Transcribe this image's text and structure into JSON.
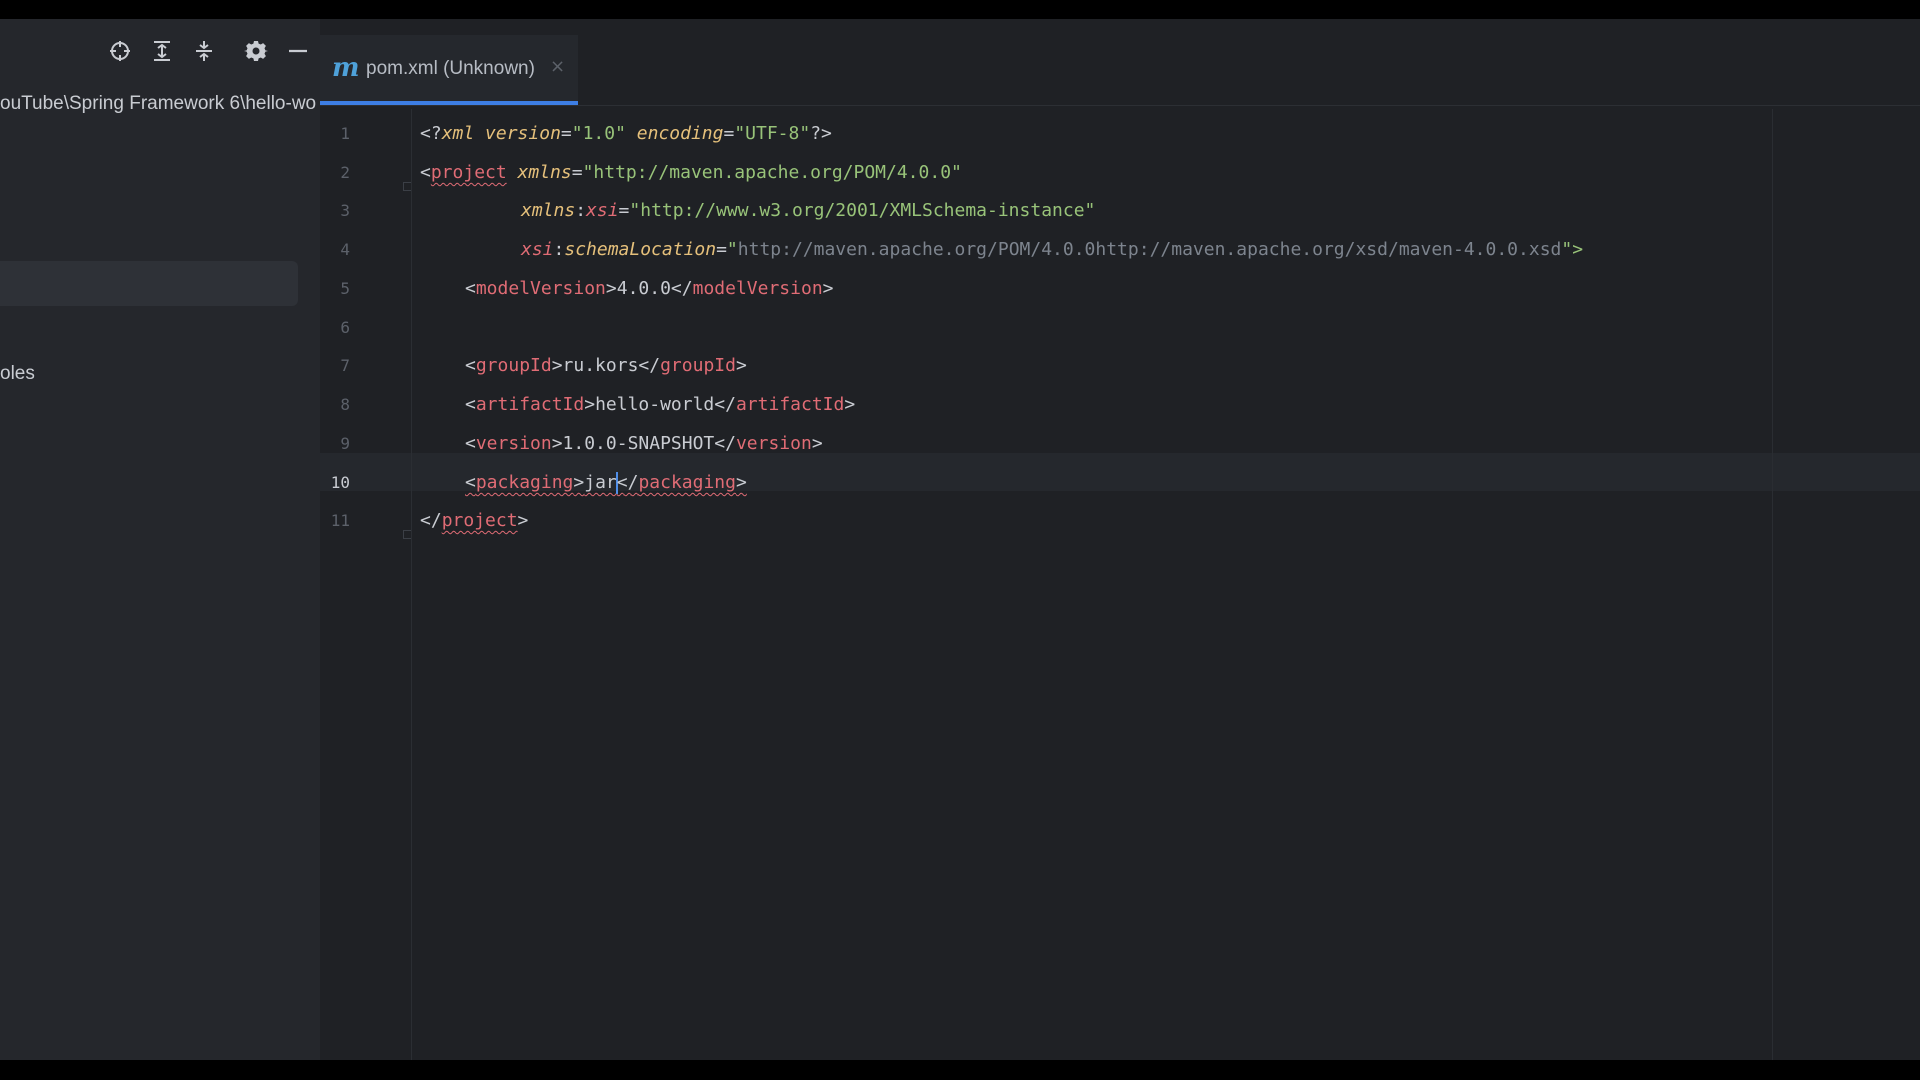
{
  "sidebar": {
    "toolbar": {
      "icons": [
        "locate-icon",
        "expand-all-icon",
        "collapse-all-icon",
        "gear-icon",
        "hide-icon"
      ]
    },
    "project_path": "ouTube\\Spring Framework 6\\hello-wo",
    "scratches_label": "oles"
  },
  "tab": {
    "icon_letter": "m",
    "label": "pom.xml (Unknown)",
    "close": "×"
  },
  "editor": {
    "current_line": 10,
    "line_numbers": [
      "1",
      "2",
      "3",
      "4",
      "5",
      "6",
      "7",
      "8",
      "9",
      "10",
      "11"
    ],
    "code": {
      "l1": {
        "open": "<?",
        "pi_name": "xml",
        "attr1": "version",
        "eq1": "=",
        "val1": "\"1.0\"",
        "attr2": "encoding",
        "eq2": "=",
        "val2": "\"UTF-8\"",
        "close": "?>"
      },
      "l2": {
        "open": "<",
        "tag": "project",
        "attr": "xmlns",
        "eq": "=",
        "val": "\"http://maven.apache.org/POM/4.0.0\""
      },
      "l3": {
        "attr_prefix": "xmlns",
        "colon": ":",
        "attr_ns": "xsi",
        "eq": "=",
        "val": "\"http://www.w3.org/2001/XMLSchema-instance\""
      },
      "l4": {
        "attr_ns": "xsi",
        "colon": ":",
        "attr_name": "schemaLocation",
        "eq": "=",
        "quote_open": "\"",
        "val": "http://maven.apache.org/POM/4.0.0http://maven.apache.org/xsd/maven-4.0.0.xsd",
        "close": "\">"
      },
      "l5": {
        "tag": "modelVersion",
        "value": "4.0.0"
      },
      "l7": {
        "tag": "groupId",
        "value": "ru.kors"
      },
      "l8": {
        "tag": "artifactId",
        "value": "hello-world"
      },
      "l9": {
        "tag": "version",
        "value": "1.0.0-SNAPSHOT"
      },
      "l10": {
        "tag": "packaging",
        "value": "jar"
      },
      "l11": {
        "tag": "project"
      }
    }
  },
  "colors": {
    "tag": "#e06c75",
    "attribute": "#e5c07b",
    "string": "#98c379",
    "text": "#c9ccd2",
    "accent": "#3d7ee4",
    "background": "#1f2125"
  }
}
